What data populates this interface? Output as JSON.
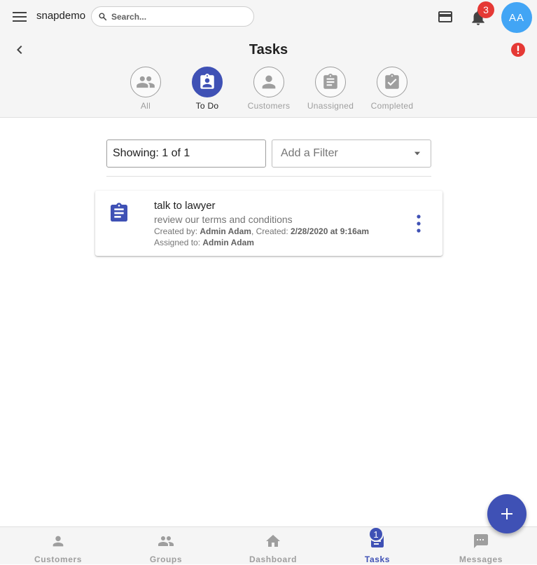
{
  "header": {
    "app_name": "snapdemo",
    "search": {
      "placeholder": "Search...",
      "value": ""
    },
    "notifications_count": "3",
    "avatar_initials": "AA"
  },
  "page": {
    "title": "Tasks"
  },
  "tabs": [
    {
      "label": "All",
      "icon": "group-icon",
      "active": false
    },
    {
      "label": "To Do",
      "icon": "assignment-ind-icon",
      "active": true
    },
    {
      "label": "Customers",
      "icon": "person-icon",
      "active": false
    },
    {
      "label": "Unassigned",
      "icon": "clipboard-icon",
      "active": false
    },
    {
      "label": "Completed",
      "icon": "clipboard-check-icon",
      "active": false
    }
  ],
  "filters": {
    "showing_text": "Showing: 1 of 1",
    "add_filter_placeholder": "Add a Filter"
  },
  "tasks": [
    {
      "title": "talk to lawyer",
      "description": "review our terms and conditions",
      "created_by_label": "Created by:",
      "created_by": "Admin Adam",
      "created_label": ", Created:",
      "created_at": "2/28/2020 at 9:16am",
      "assigned_to_label": "Assigned to:",
      "assigned_to": "Admin Adam"
    }
  ],
  "bottom_nav": [
    {
      "label": "Customers",
      "icon": "person-icon",
      "active": false
    },
    {
      "label": "Groups",
      "icon": "group-icon",
      "active": false
    },
    {
      "label": "Dashboard",
      "icon": "home-icon",
      "active": false
    },
    {
      "label": "Tasks",
      "icon": "assignment-icon",
      "active": true,
      "badge": "1"
    },
    {
      "label": "Messages",
      "icon": "message-icon",
      "active": false
    }
  ],
  "colors": {
    "primary": "#3f51b5",
    "avatar": "#42a5f5",
    "badge_red": "#e53935",
    "error_red": "#e53935",
    "inactive": "#9e9e9e"
  }
}
